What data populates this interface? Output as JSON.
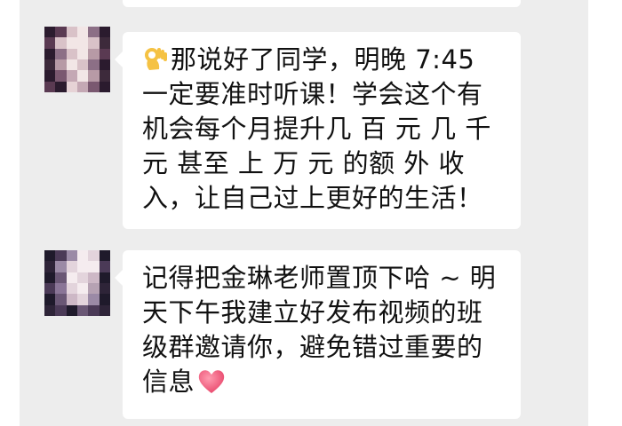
{
  "conversation": {
    "messages": [
      {
        "sender_avatar": "pixelated-avatar",
        "leading_emoji": "ok-hand-emoji",
        "text": "那说好了同学，明晚 7:45 一定要准时听课！学会这个有机会每个月提升几 百 元 几 千 元 甚至 上 万 元 的额 外 收 入，让自己过上更好的生活！"
      },
      {
        "sender_avatar": "pixelated-avatar",
        "text": "记得把金琳老师置顶下哈 ~ 明天下午我建立好发布视频的班级群邀请你，避免错过重要的信息",
        "trailing_emoji": "heart-emoji"
      }
    ]
  },
  "colors": {
    "chat_background": "#ededed",
    "bubble_background": "#ffffff",
    "text": "#111111",
    "heart": "#f0607e",
    "ok_hand": "#f5c243"
  }
}
